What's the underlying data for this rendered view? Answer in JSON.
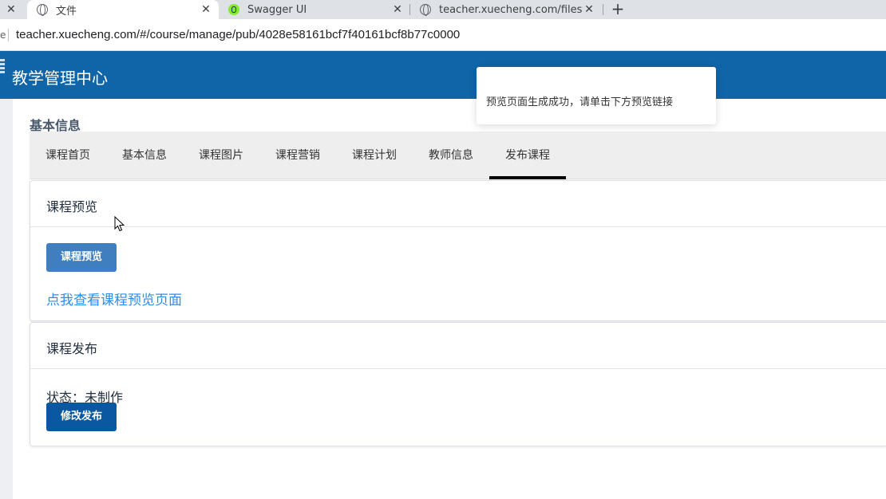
{
  "browser": {
    "tabs": [
      {
        "title": "文件",
        "active": true
      },
      {
        "title": "Swagger UI",
        "active": false
      },
      {
        "title": "teacher.xuecheng.com/filesyst",
        "active": false
      }
    ],
    "close_glyph": "✕",
    "new_tab_glyph": "+",
    "address_edge": "e",
    "url": "teacher.xuecheng.com/#/course/manage/pub/4028e58161bcf7f40161bcf8b77c0000"
  },
  "app": {
    "title": "教学管理中心",
    "brand_color": "#0f65a7"
  },
  "section_title": "基本信息",
  "nav_tabs": [
    {
      "label": "课程首页"
    },
    {
      "label": "基本信息"
    },
    {
      "label": "课程图片"
    },
    {
      "label": "课程营销"
    },
    {
      "label": "课程计划"
    },
    {
      "label": "教师信息"
    },
    {
      "label": "发布课程",
      "active": true
    }
  ],
  "preview_panel": {
    "title": "课程预览",
    "button_label": "课程预览",
    "link_text": "点我查看课程预览页面"
  },
  "publish_panel": {
    "title": "课程发布",
    "status_text": "状态：未制作",
    "button_label": "修改发布"
  },
  "toast": {
    "message": "预览页面生成成功，请单击下方预览链接"
  }
}
